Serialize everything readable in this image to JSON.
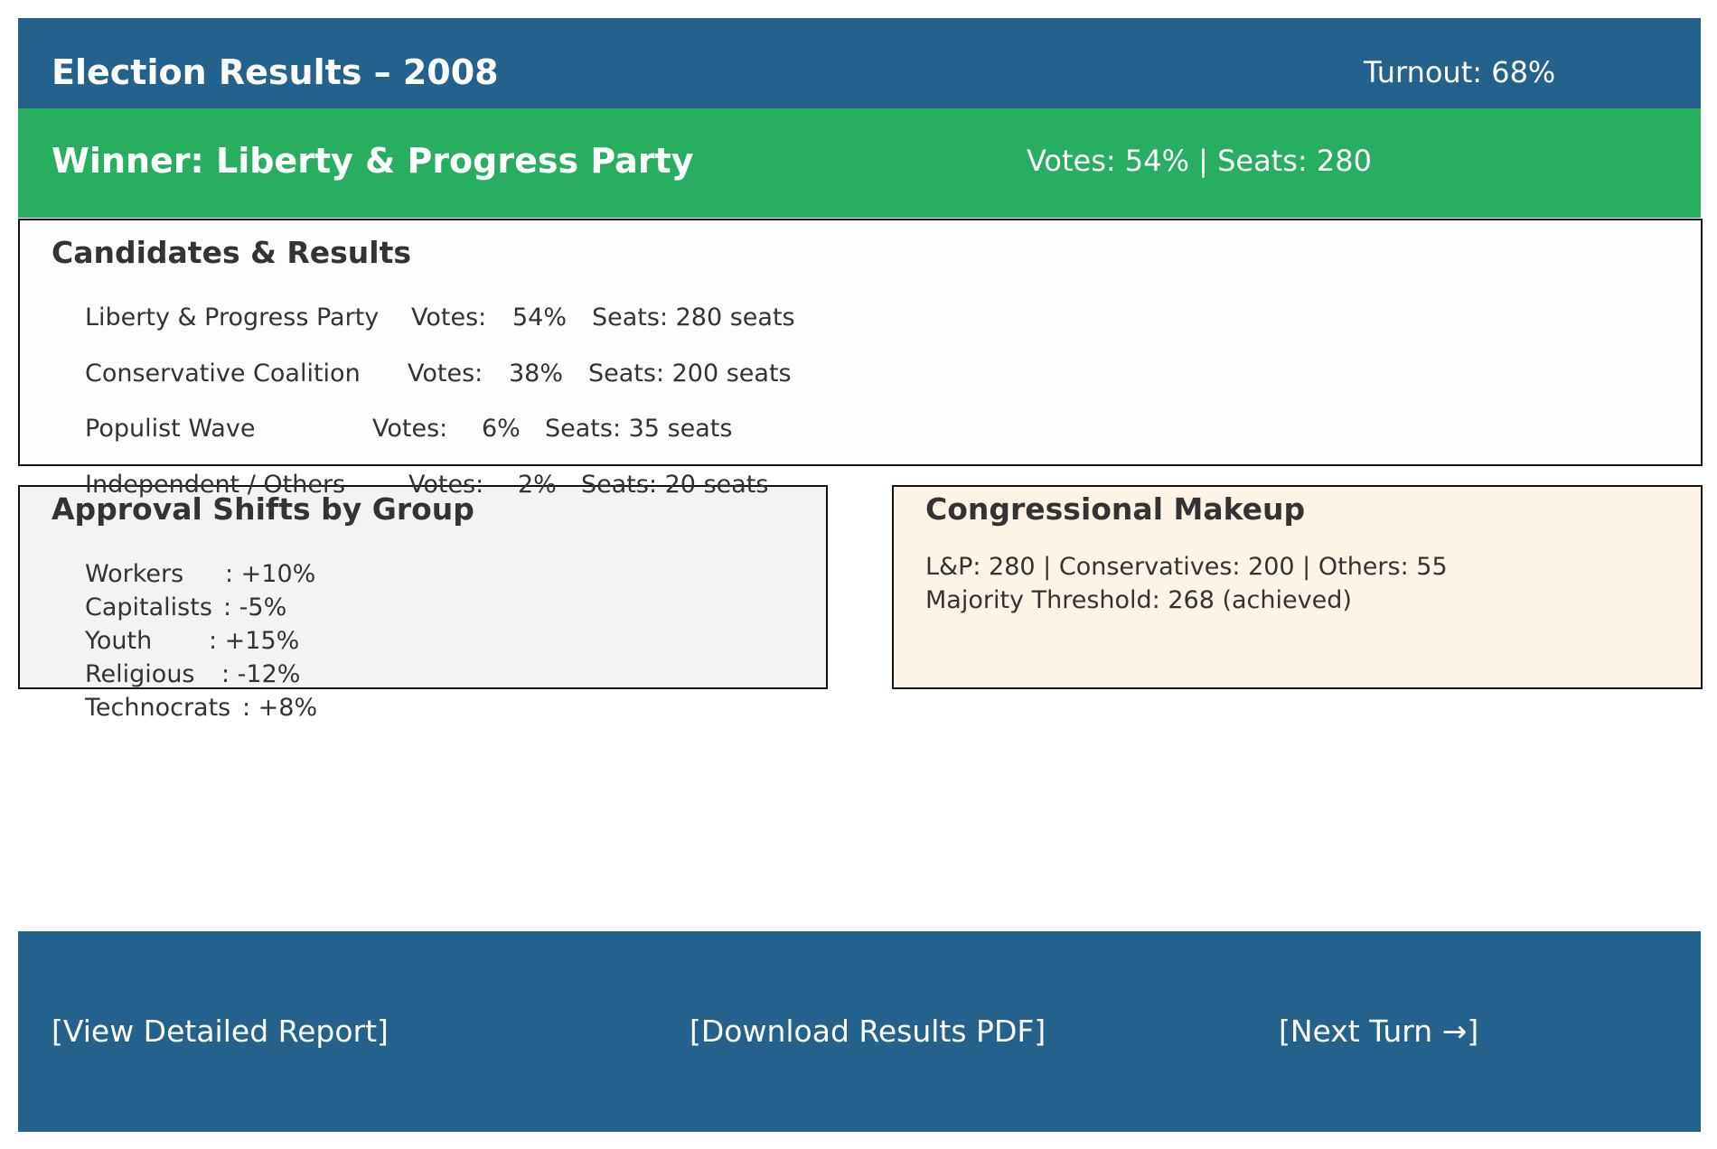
{
  "header": {
    "title": "Election Results – 2008",
    "turnout": "Turnout: 68%"
  },
  "winner": {
    "label": "Winner: Liberty & Progress Party",
    "summary": "Votes: 54% | Seats: 280"
  },
  "candidates": {
    "title": "Candidates & Results",
    "rows": [
      {
        "name": "Liberty & Progress Party",
        "votes_label": "Votes:",
        "votes": "54%",
        "seats": "Seats: 280 seats"
      },
      {
        "name": "Conservative Coalition",
        "votes_label": "Votes:",
        "votes": "38%",
        "seats": "Seats: 200 seats"
      },
      {
        "name": "Populist Wave",
        "votes_label": "Votes:",
        "votes": "6%",
        "seats": "Seats: 35 seats"
      },
      {
        "name": "Independent / Others",
        "votes_label": "Votes:",
        "votes": "2%",
        "seats": "Seats: 20 seats"
      }
    ]
  },
  "approval": {
    "title": "Approval Shifts by Group",
    "rows": [
      {
        "group": "Workers",
        "shift": ": +10%"
      },
      {
        "group": "Capitalists",
        "shift": ": -5%"
      },
      {
        "group": "Youth",
        "shift": ": +15%"
      },
      {
        "group": "Religious",
        "shift": ": -12%"
      },
      {
        "group": "Technocrats",
        "shift": ": +8%"
      }
    ]
  },
  "congress": {
    "title": "Congressional Makeup",
    "line1": "L&P: 280 | Conservatives: 200 | Others: 55",
    "line2": "Majority Threshold: 268 (achieved)"
  },
  "footer": {
    "report_label": "[View Detailed Report]",
    "pdf_label": "[Download Results PDF]",
    "next_label": "[Next Turn →]"
  },
  "colors": {
    "header_bg": "#22628d",
    "winner_bg": "#27ae60",
    "approval_bg": "#f2f3f5",
    "congress_bg": "#fdf3e6"
  }
}
